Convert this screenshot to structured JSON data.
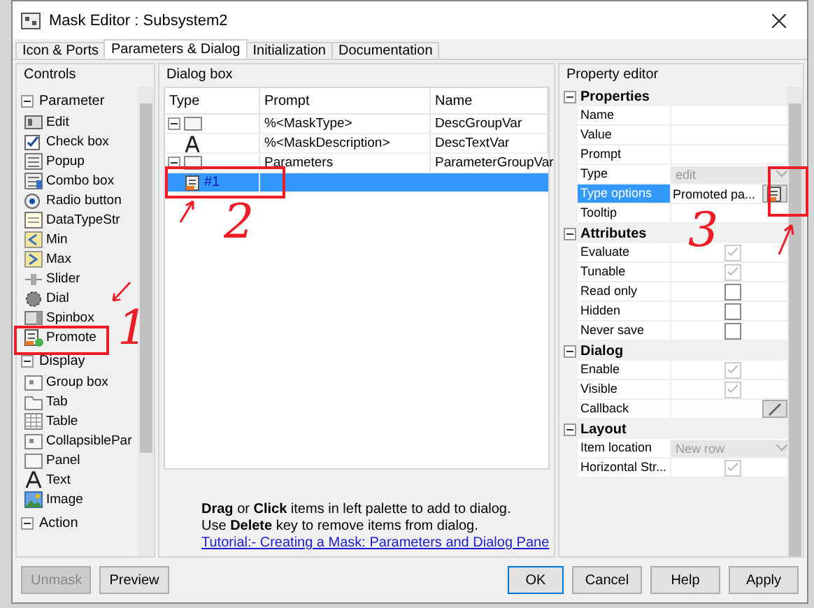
{
  "window": {
    "title": "Mask Editor : Subsystem2"
  },
  "tabs": [
    {
      "label": "Icon & Ports",
      "selected": false
    },
    {
      "label": "Parameters & Dialog",
      "selected": true
    },
    {
      "label": "Initialization",
      "selected": false
    },
    {
      "label": "Documentation",
      "selected": false
    }
  ],
  "controls": {
    "title": "Controls",
    "groups": [
      {
        "label": "Parameter",
        "expanded": true,
        "items": [
          {
            "label": "Edit",
            "kind": "edit"
          },
          {
            "label": "Check box",
            "kind": "checkbox"
          },
          {
            "label": "Popup",
            "kind": "popup"
          },
          {
            "label": "Combo box",
            "kind": "combo"
          },
          {
            "label": "Radio button",
            "kind": "radio"
          },
          {
            "label": "DataTypeStr",
            "kind": "datatype"
          },
          {
            "label": "Min",
            "kind": "min"
          },
          {
            "label": "Max",
            "kind": "max"
          },
          {
            "label": "Slider",
            "kind": "slider"
          },
          {
            "label": "Dial",
            "kind": "dial"
          },
          {
            "label": "Spinbox",
            "kind": "spinbox"
          },
          {
            "label": "Promote",
            "kind": "promote"
          }
        ]
      },
      {
        "label": "Display",
        "expanded": true,
        "items": [
          {
            "label": "Group box",
            "kind": "groupbox"
          },
          {
            "label": "Tab",
            "kind": "tab"
          },
          {
            "label": "Table",
            "kind": "table"
          },
          {
            "label": "CollapsiblePar",
            "kind": "collapsible"
          },
          {
            "label": "Panel",
            "kind": "panel"
          },
          {
            "label": "Text",
            "kind": "text"
          },
          {
            "label": "Image",
            "kind": "image"
          }
        ]
      },
      {
        "label": "Action",
        "expanded": true
      }
    ]
  },
  "dialog_box": {
    "title": "Dialog box",
    "columns": [
      "Type",
      "Prompt",
      "Name"
    ],
    "rows": [
      {
        "kind": "group",
        "expanded": true,
        "selected": false,
        "prompt": "%<MaskType>",
        "name": "DescGroupVar",
        "children": [
          {
            "kind": "text",
            "selected": false,
            "prompt": "%<MaskDescription>",
            "name": "DescTextVar"
          }
        ]
      },
      {
        "kind": "group",
        "expanded": true,
        "selected": false,
        "prompt": "Parameters",
        "name": "ParameterGroupVar",
        "children": [
          {
            "kind": "promote",
            "label": "#1",
            "selected": true
          }
        ]
      }
    ],
    "hint_lines": [
      "**Drag** or **Click** items in left palette to add to dialog.",
      "Use **Delete** key to remove items from dialog."
    ],
    "tutorial_link": "Tutorial:- Creating a Mask: Parameters and Dialog Pane"
  },
  "property_editor": {
    "title": "Property editor",
    "sections": [
      {
        "label": "Properties",
        "expanded": true,
        "rows": [
          {
            "label": "Name",
            "kind": "text",
            "selected": false
          },
          {
            "label": "Value",
            "kind": "text",
            "selected": false
          },
          {
            "label": "Prompt",
            "kind": "text",
            "selected": false
          },
          {
            "label": "Type",
            "kind": "dropdown",
            "value": "edit",
            "disabled": true,
            "selected": false
          },
          {
            "label": "Type options",
            "kind": "button",
            "value": "Promoted pa...",
            "selected": true
          },
          {
            "label": "Tooltip",
            "kind": "text",
            "selected": false
          }
        ]
      },
      {
        "label": "Attributes",
        "expanded": true,
        "rows": [
          {
            "label": "Evaluate",
            "kind": "checkbox",
            "checked": true,
            "disabled": true,
            "selected": false
          },
          {
            "label": "Tunable",
            "kind": "checkbox",
            "checked": true,
            "disabled": true,
            "selected": false
          },
          {
            "label": "Read only",
            "kind": "checkbox",
            "checked": false,
            "disabled": false,
            "selected": false
          },
          {
            "label": "Hidden",
            "kind": "checkbox",
            "checked": false,
            "disabled": false,
            "selected": false
          },
          {
            "label": "Never save",
            "kind": "checkbox",
            "checked": false,
            "disabled": false,
            "selected": false
          }
        ]
      },
      {
        "label": "Dialog",
        "expanded": true,
        "rows": [
          {
            "label": "Enable",
            "kind": "checkbox",
            "checked": true,
            "disabled": true,
            "selected": false
          },
          {
            "label": "Visible",
            "kind": "checkbox",
            "checked": true,
            "disabled": true,
            "selected": false
          },
          {
            "label": "Callback",
            "kind": "editor",
            "selected": false
          }
        ]
      },
      {
        "label": "Layout",
        "expanded": true,
        "rows": [
          {
            "label": "Item location",
            "kind": "dropdown",
            "value": "New row",
            "disabled": true,
            "selected": false
          },
          {
            "label": "Horizontal Str...",
            "kind": "checkbox",
            "checked": true,
            "disabled": true,
            "selected": false
          }
        ]
      }
    ]
  },
  "buttons": [
    {
      "label": "Unmask",
      "disabled": true,
      "default": false
    },
    {
      "label": "Preview",
      "disabled": false,
      "default": false
    },
    {
      "label": "OK",
      "disabled": false,
      "default": true
    },
    {
      "label": "Cancel",
      "disabled": false,
      "default": false
    },
    {
      "label": "Help",
      "disabled": false,
      "default": false
    },
    {
      "label": "Apply",
      "disabled": false,
      "default": false
    }
  ],
  "annotations": [
    {
      "label": "1"
    },
    {
      "label": "2"
    },
    {
      "label": "3"
    }
  ]
}
